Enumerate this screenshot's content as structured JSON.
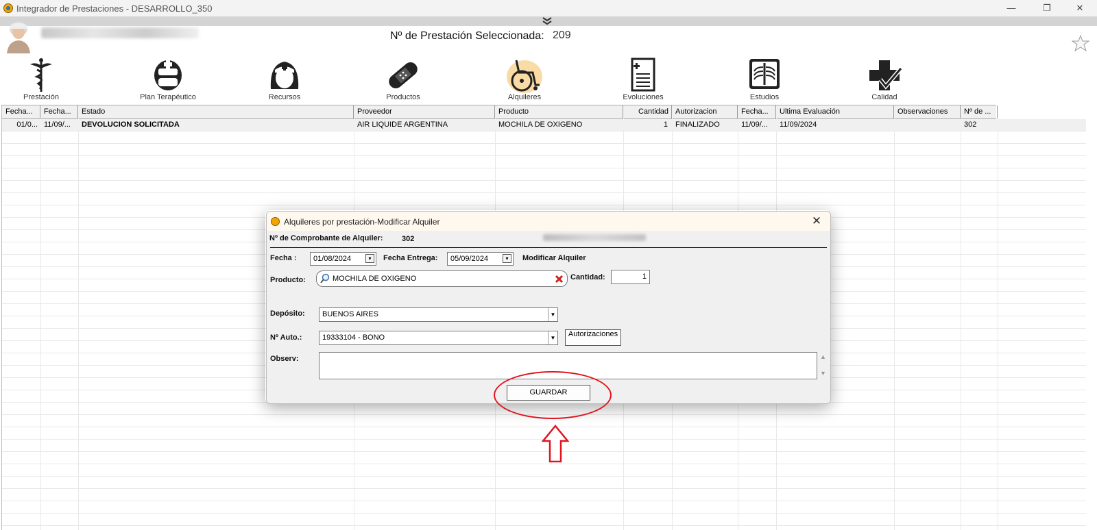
{
  "window": {
    "title": "Integrador de Prestaciones - DESARROLLO_350",
    "minimize": "—",
    "restore": "❐",
    "close": "✕"
  },
  "header": {
    "selected_label": "Nº de Prestación Seleccionada:",
    "selected_value": "209"
  },
  "toolbar": [
    {
      "label": "Prestación",
      "icon": "caduceus-icon"
    },
    {
      "label": "Plan Terapéutico",
      "icon": "nurse-mask-icon"
    },
    {
      "label": "Recursos",
      "icon": "nurse-icon"
    },
    {
      "label": "Productos",
      "icon": "bandage-icon"
    },
    {
      "label": "Alquileres",
      "icon": "wheelchair-icon"
    },
    {
      "label": "Evoluciones",
      "icon": "clipboard-icon"
    },
    {
      "label": "Estudios",
      "icon": "xray-icon"
    },
    {
      "label": "Calidad",
      "icon": "medical-cross-check-icon"
    }
  ],
  "grid": {
    "columns": [
      "Fecha...",
      "Fecha...",
      "Estado",
      "Proveedor",
      "Producto",
      "Cantidad",
      "Autorizacion",
      "Fecha...",
      "Ultima Evaluación",
      "Observaciones",
      "Nº de ..."
    ],
    "rows": [
      [
        "01/0...",
        "11/09/...",
        "DEVOLUCION SOLICITADA",
        "AIR LIQUIDE ARGENTINA",
        "MOCHILA DE OXIGENO",
        "1",
        "FINALIZADO",
        "11/09/...",
        "11/09/2024",
        "",
        "302"
      ]
    ]
  },
  "dialog": {
    "title": "Alquileres por prestación-Modificar Alquiler",
    "comprobante_label": "Nº de Comprobante de Alquiler:",
    "comprobante_value": "302",
    "fecha_label": "Fecha :",
    "fecha_value": "01/08/2024",
    "fecha_entrega_label": "Fecha Entrega:",
    "fecha_entrega_value": "05/09/2024",
    "mode_label": "Modificar Alquiler",
    "producto_label": "Producto:",
    "producto_value": "MOCHILA DE OXIGENO",
    "cantidad_label": "Cantidad:",
    "cantidad_value": "1",
    "deposito_label": "Depósito:",
    "deposito_value": "BUENOS AIRES",
    "auto_label": "Nº Auto.:",
    "auto_value": "19333104 - BONO",
    "autorizaciones_button": "Autorizaciones",
    "observ_label": "Observ:",
    "observ_value": "",
    "save_button": "GUARDAR"
  },
  "colors": {
    "highlight": "#e0141e",
    "dialog_title_bg": "#fff8ee"
  }
}
